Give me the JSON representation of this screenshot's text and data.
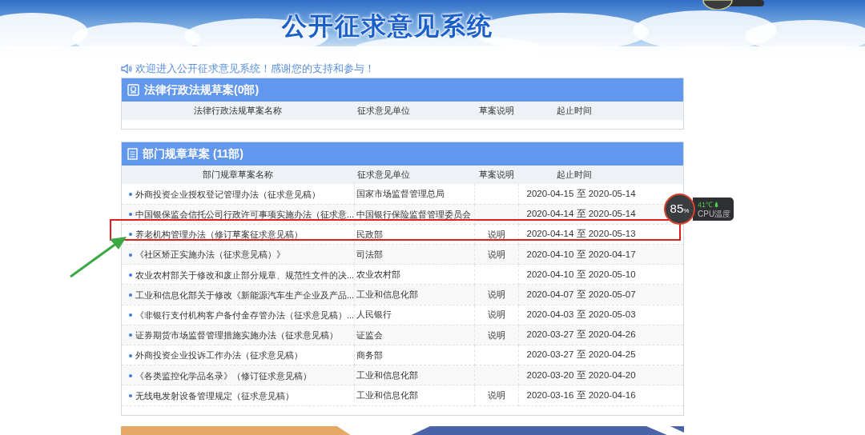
{
  "header": {
    "title": "公开征求意见系统"
  },
  "welcome": "欢迎进入公开征求意见系统！感谢您的支持和参与！",
  "sections": [
    {
      "kind": "law",
      "title": "法律行政法规草案(0部)",
      "columns": [
        "法律行政法规草案名称",
        "征求意见单位",
        "草案说明",
        "起止时间"
      ]
    },
    {
      "kind": "rule",
      "title": "部门规章草案 (11部)",
      "columns": [
        "部门规章草案名称",
        "征求意见单位",
        "草案说明",
        "起止时间"
      ],
      "rows": [
        {
          "name": "外商投资企业授权登记管理办法（征求意见稿）",
          "unit": "国家市场监督管理总局",
          "period": "2020-04-15 至 2020-05-14",
          "highlighted": false
        },
        {
          "name": "中国银保监会信托公司行政许可事项实施办法（征求意...",
          "unit": "中国银行保险监督管理委员会",
          "period": "2020-04-14 至 2020-05-14",
          "highlighted": false
        },
        {
          "name": "养老机构管理办法（修订草案征求意见稿）",
          "unit": "民政部",
          "note": "说明",
          "period": "2020-04-14 至 2020-05-13",
          "highlighted": true
        },
        {
          "name": "《社区矫正实施办法（征求意见稿）》",
          "unit": "司法部",
          "note": "说明",
          "period": "2020-04-10 至 2020-04-17",
          "highlighted": false
        },
        {
          "name": "农业农村部关于修改和废止部分规章、规范性文件的决...",
          "unit": "农业农村部",
          "period": "2020-04-10 至 2020-05-10",
          "highlighted": false
        },
        {
          "name": "工业和信息化部关于修改《新能源汽车生产企业及产品...",
          "unit": "工业和信息化部",
          "note": "说明",
          "period": "2020-04-07 至 2020-05-07",
          "highlighted": false
        },
        {
          "name": "《非银行支付机构客户备付金存管办法（征求意见稿）...",
          "unit": "人民银行",
          "note": "说明",
          "period": "2020-04-03 至 2020-05-03",
          "highlighted": false
        },
        {
          "name": "证券期货市场监督管理措施实施办法（征求意见稿）",
          "unit": "证监会",
          "note": "说明",
          "period": "2020-03-27 至 2020-04-26",
          "highlighted": false
        },
        {
          "name": "外商投资企业投诉工作办法（征求意见稿）",
          "unit": "商务部",
          "period": "2020-03-27 至 2020-04-25",
          "highlighted": false
        },
        {
          "name": "《各类监控化学品名录》（修订征求意见稿）",
          "unit": "工业和信息化部",
          "period": "2020-03-20 至 2020-04-20",
          "highlighted": false
        },
        {
          "name": "无线电发射设备管理规定（征求意见稿）",
          "unit": "工业和信息化部",
          "note": "说明",
          "period": "2020-03-16 至 2020-04-16",
          "highlighted": false
        }
      ]
    }
  ],
  "cpu_widget": {
    "usage": "85",
    "unit": "%",
    "temperature": "41℃",
    "label": "CPU温度"
  }
}
